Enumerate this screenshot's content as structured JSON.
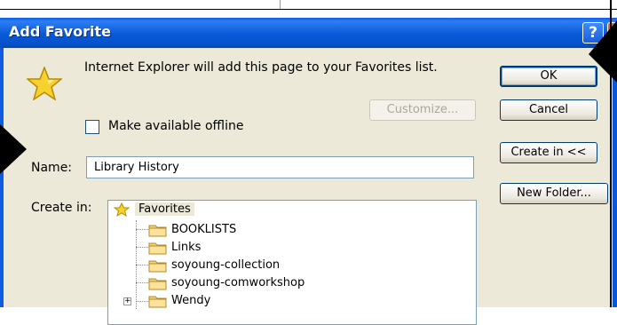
{
  "dialog": {
    "title": "Add Favorite",
    "help_label": "?",
    "message": "Internet Explorer will add this page to your Favorites list.",
    "offline_label": "Make available offline",
    "offline_checked": false,
    "buttons": {
      "ok": "OK",
      "cancel": "Cancel",
      "customize": "Customize...",
      "create_in": "Create in <<",
      "new_folder": "New Folder..."
    },
    "name_label": "Name:",
    "name_value": "Library History",
    "create_in_label": "Create in:",
    "tree": {
      "root": "Favorites",
      "items": [
        "BOOKLISTS",
        "Links",
        "soyoung-collection",
        "soyoung-comworkshop",
        "Wendy"
      ]
    }
  },
  "colors": {
    "titlebar": "#0859d8",
    "dialog_bg": "#ece9d8",
    "button_border": "#003c74",
    "star": "#f5c518"
  },
  "icons": [
    "star-icon",
    "folder-icon",
    "help-icon",
    "close-icon",
    "checkbox",
    "expand-plus-icon",
    "arrow-pointer-icon"
  ]
}
